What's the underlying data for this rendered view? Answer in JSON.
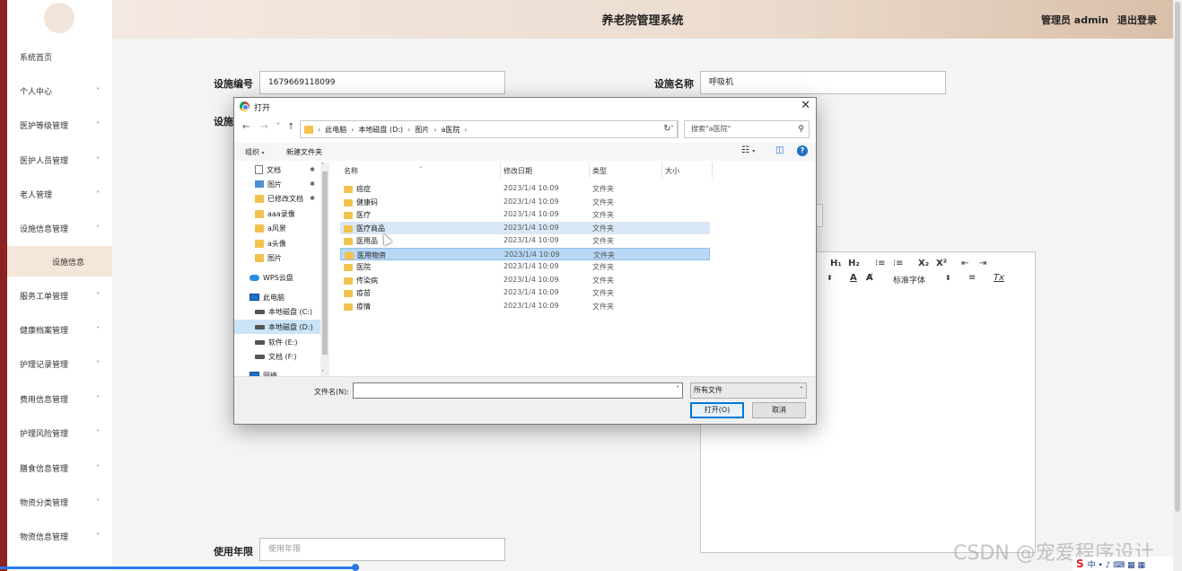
{
  "header": {
    "title": "养老院管理系统",
    "user": "管理员 admin",
    "logout": "退出登录"
  },
  "sidebar": {
    "items": [
      {
        "label": "系统首页",
        "chevron": ""
      },
      {
        "label": "个人中心",
        "chevron": "˅"
      },
      {
        "label": "医护等级管理",
        "chevron": "˅"
      },
      {
        "label": "医护人员管理",
        "chevron": "˅"
      },
      {
        "label": "老人管理",
        "chevron": "˅"
      },
      {
        "label": "设施信息管理",
        "chevron": "˄"
      },
      {
        "label": "服务工单管理",
        "chevron": "˅"
      },
      {
        "label": "健康档案管理",
        "chevron": "˅"
      },
      {
        "label": "护理记录管理",
        "chevron": "˅"
      },
      {
        "label": "费用信息管理",
        "chevron": "˅"
      },
      {
        "label": "护理风险管理",
        "chevron": "˅"
      },
      {
        "label": "膳食信息管理",
        "chevron": "˅"
      },
      {
        "label": "物资分类管理",
        "chevron": "˅"
      },
      {
        "label": "物资信息管理",
        "chevron": "˅"
      }
    ],
    "active_sub": "设施信息"
  },
  "form": {
    "code_label": "设施编号",
    "code_value": "1679669118099",
    "name_label": "设施名称",
    "name_value": "呼吸机",
    "partial_label": "设施",
    "years_label": "使用年限",
    "years_placeholder": "使用年限"
  },
  "editor": {
    "h1": "H₁",
    "h2": "H₂",
    "ol": "⁝≡",
    "ul": "⁝≡",
    "sub": "X₂",
    "sup": "X²",
    "indent_l": "⇤",
    "indent_r": "⇥",
    "size_arrow": "⬍",
    "color": "A",
    "bg": "A̸",
    "font": "标准字体",
    "font_arrow": "⬍",
    "align": "≡",
    "clear": "Tx"
  },
  "dialog": {
    "title": "打开",
    "close": "✕",
    "back": "←",
    "forward": "→",
    "recent": "˅",
    "up": "↑",
    "path": [
      "此电脑",
      "本地磁盘 (D:)",
      "图片",
      "a医院"
    ],
    "path_sep": "›",
    "addr_dropdown": "˅",
    "refresh": "↻",
    "search_placeholder": "搜索\"a医院\"",
    "search_icon": "⚲",
    "organize": "组织",
    "organize_arrow": "▾",
    "new_folder": "新建文件夹",
    "view_icon": "☷",
    "view_arrow": "▾",
    "pane_icon": "◫",
    "help_icon": "?",
    "pin": "✱",
    "scroll_up": "˄",
    "scroll_down": "˅",
    "nav": [
      {
        "label": "文档",
        "icon": "doc",
        "pin": true
      },
      {
        "label": "图片",
        "icon": "img",
        "pin": true
      },
      {
        "label": "已修改文档",
        "icon": "folder",
        "pin": true
      },
      {
        "label": "aaa录像",
        "icon": "folder",
        "pin": false
      },
      {
        "label": "a风景",
        "icon": "folder",
        "pin": false
      },
      {
        "label": "a头像",
        "icon": "folder",
        "pin": false
      },
      {
        "label": "图片",
        "icon": "folder",
        "pin": false
      },
      {
        "label": "WPS云盘",
        "icon": "cloud",
        "pin": false
      },
      {
        "label": "此电脑",
        "icon": "pc",
        "pin": false
      },
      {
        "label": "本地磁盘 (C:)",
        "icon": "disk",
        "pin": false
      },
      {
        "label": "本地磁盘 (D:)",
        "icon": "disk",
        "pin": false,
        "selected": true
      },
      {
        "label": "软件 (E:)",
        "icon": "disk",
        "pin": false
      },
      {
        "label": "文档 (F:)",
        "icon": "disk",
        "pin": false
      },
      {
        "label": "网络",
        "icon": "pc",
        "pin": false
      }
    ],
    "columns": {
      "name": "名称",
      "date": "修改日期",
      "type": "类型",
      "size": "大小",
      "sort_arrow": "˄"
    },
    "files": [
      {
        "name": "癌症",
        "date": "2023/1/4 10:09",
        "type": "文件夹"
      },
      {
        "name": "健康码",
        "date": "2023/1/4 10:09",
        "type": "文件夹"
      },
      {
        "name": "医疗",
        "date": "2023/1/4 10:09",
        "type": "文件夹"
      },
      {
        "name": "医疗商品",
        "date": "2023/1/4 10:09",
        "type": "文件夹",
        "state": "hover"
      },
      {
        "name": "医用品",
        "date": "2023/1/4 10:09",
        "type": "文件夹"
      },
      {
        "name": "医用物资",
        "date": "2023/1/4 10:09",
        "type": "文件夹",
        "state": "selected"
      },
      {
        "name": "医院",
        "date": "2023/1/4 10:09",
        "type": "文件夹"
      },
      {
        "name": "传染病",
        "date": "2023/1/4 10:09",
        "type": "文件夹"
      },
      {
        "name": "疫苗",
        "date": "2023/1/4 10:09",
        "type": "文件夹"
      },
      {
        "name": "疫情",
        "date": "2023/1/4 10:09",
        "type": "文件夹"
      }
    ],
    "filename_label": "文件名(N):",
    "filename_value": "",
    "filename_dropdown": "˅",
    "filetype": "所有文件",
    "filetype_dropdown": "˅",
    "open_button": "打开(O)",
    "cancel_button": "取消",
    "grip": "⋰"
  },
  "watermark": "CSDN @宠爱程序设计",
  "ime": {
    "logo": "S",
    "text": "中 • ♪ ⌨ ▦ ▦"
  }
}
